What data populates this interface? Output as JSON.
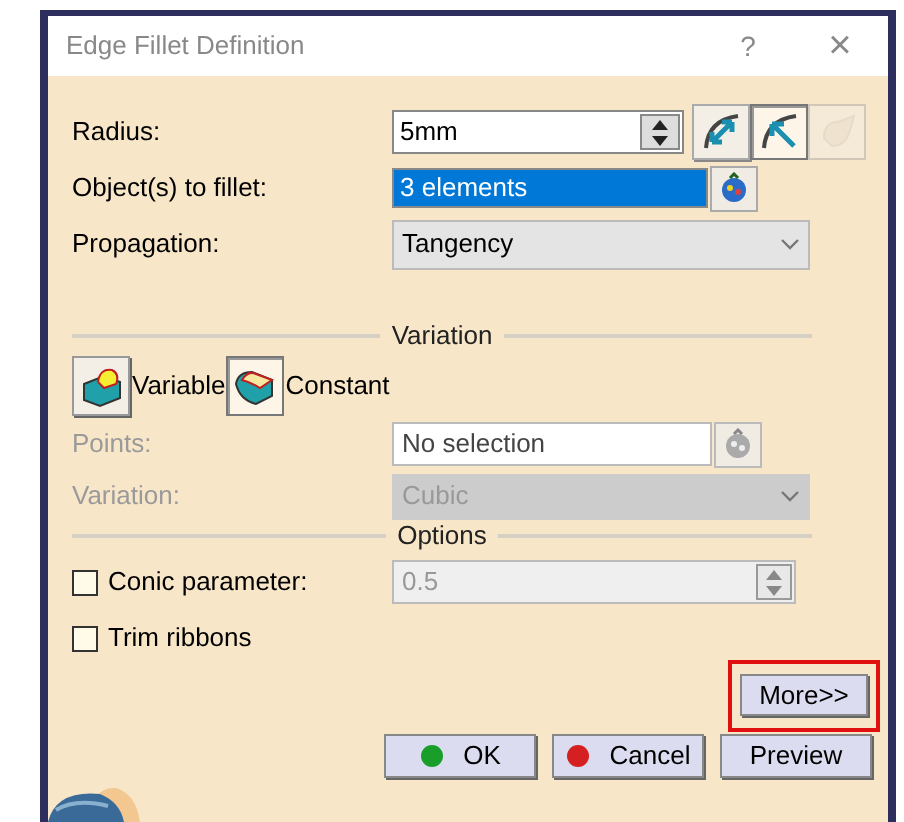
{
  "window": {
    "title": "Edge Fillet Definition",
    "help": "?",
    "close": "×"
  },
  "radius": {
    "label": "Radius:",
    "value": "5mm"
  },
  "radius_modes": [
    {
      "kind": "both-sides",
      "selected": false,
      "disabled": false
    },
    {
      "kind": "one-side",
      "selected": true,
      "disabled": false
    },
    {
      "kind": "other",
      "selected": false,
      "disabled": true
    }
  ],
  "objects": {
    "label": "Object(s) to fillet:",
    "value": "3 elements",
    "selected": true
  },
  "propagation": {
    "label": "Propagation:",
    "value": "Tangency"
  },
  "variation_section": {
    "title": "Variation",
    "modes": [
      {
        "label": "Variable",
        "kind": "variable",
        "selected": false
      },
      {
        "label": "Constant",
        "kind": "constant",
        "selected": true
      }
    ],
    "points": {
      "label": "Points:",
      "value": "No selection",
      "disabled": true
    },
    "variation": {
      "label": "Variation:",
      "value": "Cubic",
      "disabled": true
    }
  },
  "options_section": {
    "title": "Options",
    "conic": {
      "label": "Conic parameter:",
      "checked": false,
      "value": "0.5",
      "disabled": true
    },
    "trim": {
      "label": "Trim ribbons",
      "checked": false
    }
  },
  "more_button": {
    "label": "More>>",
    "highlighted": true
  },
  "buttons": [
    {
      "label": "OK",
      "kind": "ok"
    },
    {
      "label": "Cancel",
      "kind": "cancel"
    },
    {
      "label": "Preview",
      "kind": "preview"
    }
  ]
}
